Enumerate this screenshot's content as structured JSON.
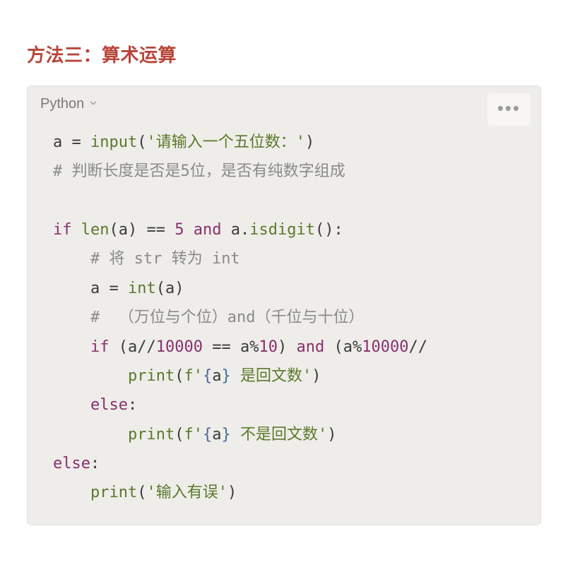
{
  "heading": "方法三：算术运算",
  "code_block": {
    "language_label": "Python",
    "more_glyph": "•••",
    "code": {
      "line1": {
        "id": "a",
        "op1": " = ",
        "fn": "input",
        "paren_open": "(",
        "str": "'请输入一个五位数：'",
        "paren_close": ")"
      },
      "line2": {
        "comment": "# 判断长度是否是5位，是否有纯数字组成"
      },
      "line3": "",
      "line4": {
        "kw_if": "if",
        "sp1": " ",
        "fn_len": "len",
        "po1": "(",
        "id_a1": "a",
        "pc1": ")",
        "sp2": " ",
        "op_eq1": "==",
        "sp3": " ",
        "num5": "5",
        "sp4": " ",
        "kw_and": "and",
        "sp5": " ",
        "id_a2": "a",
        "dot": ".",
        "fn_isd": "isdigit",
        "po2": "(",
        "pc2": ")",
        "colon": ":"
      },
      "line5": {
        "indent": "    ",
        "comment": "# 将 str 转为 int"
      },
      "line6": {
        "indent": "    ",
        "id": "a",
        "op": " = ",
        "fn": "int",
        "po": "(",
        "arg": "a",
        "pc": ")"
      },
      "line7": {
        "indent": "    ",
        "comment": "#  （万位与个位）and（千位与十位）"
      },
      "line8": {
        "indent": "    ",
        "kw_if": "if",
        "sp1": " ",
        "po1": "(",
        "id1": "a",
        "op_fd1": "//",
        "num1": "10000",
        "sp2": " ",
        "op_eq": "==",
        "sp3": " ",
        "id2": "a",
        "op_mod1": "%",
        "num2": "10",
        "pc1": ")",
        "sp4": " ",
        "kw_and": "and",
        "sp5": " ",
        "po2": "(",
        "id3": "a",
        "op_mod2": "%",
        "num3": "10000",
        "op_fd2": "//"
      },
      "line9": {
        "indent": "        ",
        "fn": "print",
        "po": "(",
        "fpre": "f",
        "q1": "'",
        "br1": "{",
        "var": "a",
        "br2": "}",
        "txt": " 是回文数",
        "q2": "'",
        "pc": ")"
      },
      "line10": {
        "indent": "    ",
        "kw": "else",
        "colon": ":"
      },
      "line11": {
        "indent": "        ",
        "fn": "print",
        "po": "(",
        "fpre": "f",
        "q1": "'",
        "br1": "{",
        "var": "a",
        "br2": "}",
        "txt": " 不是回文数",
        "q2": "'",
        "pc": ")"
      },
      "line12": {
        "kw": "else",
        "colon": ":"
      },
      "line13": {
        "indent": "    ",
        "fn": "print",
        "po": "(",
        "str": "'输入有误'",
        "pc": ")"
      }
    }
  }
}
